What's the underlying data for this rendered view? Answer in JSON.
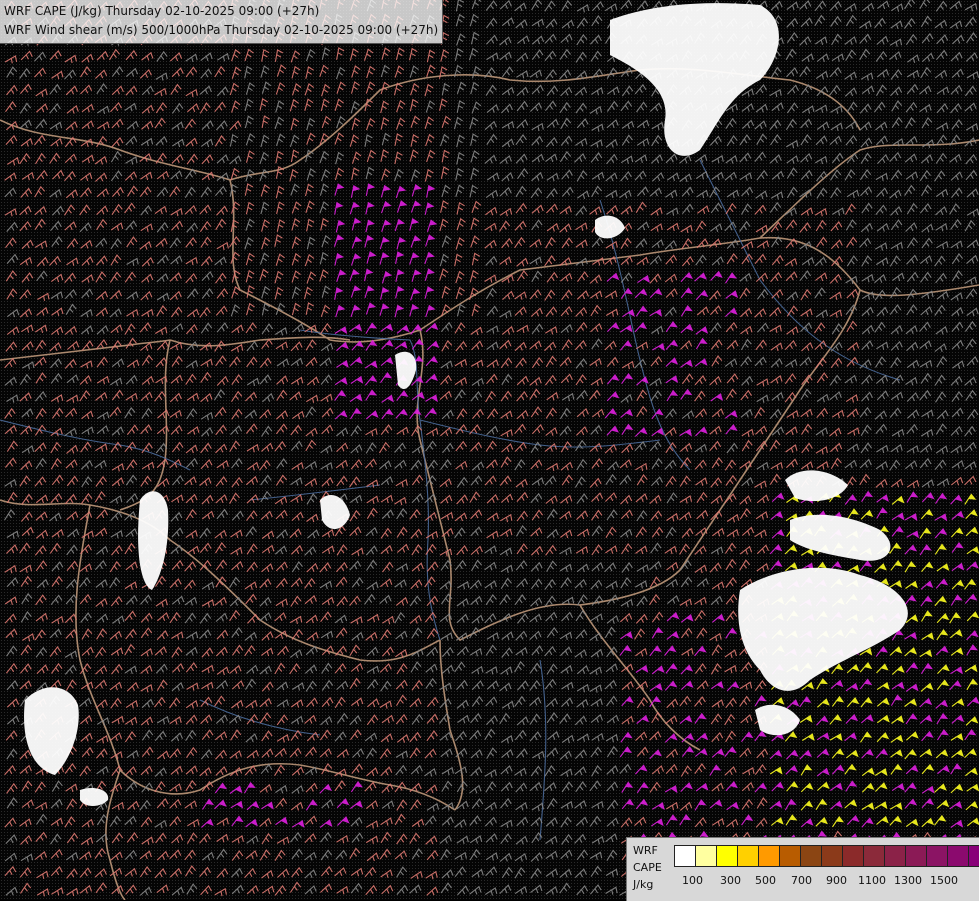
{
  "title": {
    "line1": "WRF CAPE (J/kg) Thursday 02-10-2025 09:00 (+27h)",
    "line2": "WRF Wind shear (m/s) 500/1000hPa Thursday 02-10-2025 09:00 (+27h)"
  },
  "legend": {
    "label_lines": [
      "WRF",
      "CAPE",
      "J/kg"
    ],
    "ticks": [
      "100",
      "300",
      "500",
      "700",
      "900",
      "1100",
      "1300",
      "1500"
    ],
    "colors": [
      "#ffffff",
      "#ffffa0",
      "#ffff00",
      "#ffd000",
      "#ff9a00",
      "#b85c00",
      "#8b4513",
      "#8b3a1a",
      "#8b2a2a",
      "#8b2a3a",
      "#8b2248",
      "#8b1a56",
      "#8b1464",
      "#8b0a6e",
      "#880078"
    ]
  },
  "map_colors": {
    "background": "#050505",
    "border": "#c8a080",
    "river": "#4a6a9a",
    "barb_low": "#8a8a8a",
    "barb_mid": "#e07a72",
    "barb_high": "#e020e0",
    "barb_cape": "#ffff20",
    "cloud": "#ffffff"
  }
}
